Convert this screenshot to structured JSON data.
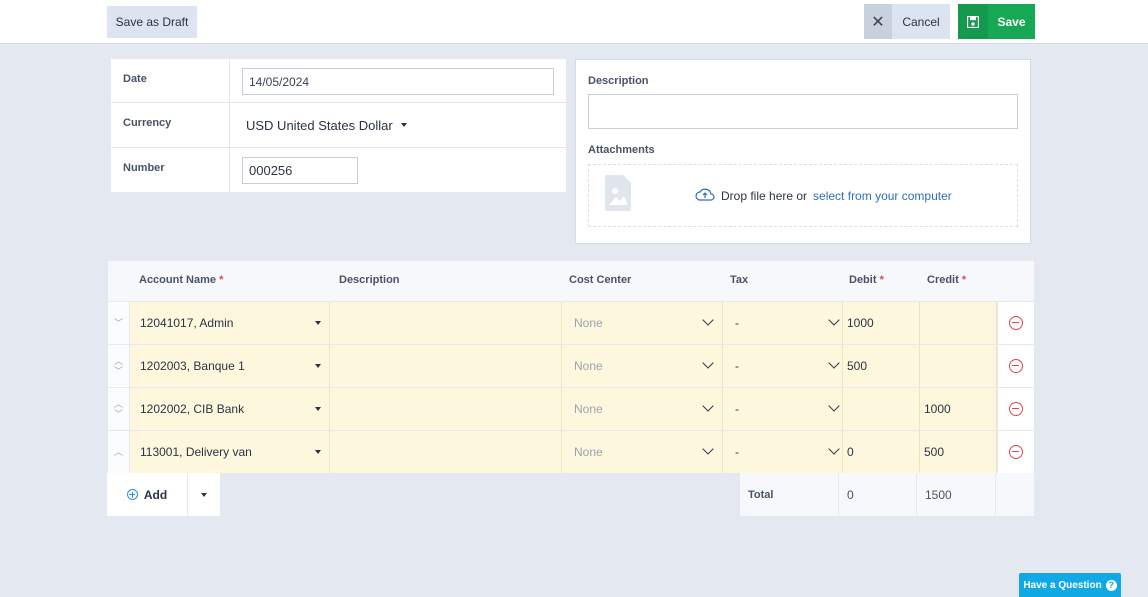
{
  "toolbar": {
    "save_draft_label": "Save as Draft",
    "cancel_label": "Cancel",
    "save_label": "Save",
    "save_color": "#17a856"
  },
  "form": {
    "date_label": "Date",
    "date_value": "14/05/2024",
    "currency_label": "Currency",
    "currency_value": "USD United States Dollar",
    "number_label": "Number",
    "number_value": "000256"
  },
  "details": {
    "description_label": "Description",
    "description_value": "",
    "attachments_label": "Attachments",
    "drop_text": "Drop file here or",
    "drop_link": "select from your computer"
  },
  "table": {
    "columns": {
      "account": "Account Name",
      "description": "Description",
      "cost_center": "Cost Center",
      "tax": "Tax",
      "debit": "Debit",
      "credit": "Credit",
      "required_mark": "*"
    },
    "rows": [
      {
        "account": "12041017, Admin",
        "description": "",
        "cost_center": "None",
        "tax": "-",
        "debit": "1000",
        "credit": ""
      },
      {
        "account": "1202003, Banque 1",
        "description": "",
        "cost_center": "None",
        "tax": "-",
        "debit": "500",
        "credit": ""
      },
      {
        "account": "1202002, CIB Bank",
        "description": "",
        "cost_center": "None",
        "tax": "-",
        "debit": "",
        "credit": "1000"
      },
      {
        "account": "113001, Delivery van",
        "description": "",
        "cost_center": "None",
        "tax": "-",
        "debit": "0",
        "credit": "500"
      }
    ],
    "add_label": "Add",
    "total_label": "Total",
    "total_debit": "0",
    "total_credit": "1500"
  },
  "help": {
    "label": "Have a Question",
    "color": "#11a8e6"
  },
  "icons": [
    "close-icon",
    "save-icon",
    "caret-down-icon",
    "file-image-icon",
    "cloud-upload-icon",
    "chevron-up-icon",
    "chevron-down-icon",
    "remove-row-icon",
    "add-circle-icon",
    "question-icon"
  ]
}
